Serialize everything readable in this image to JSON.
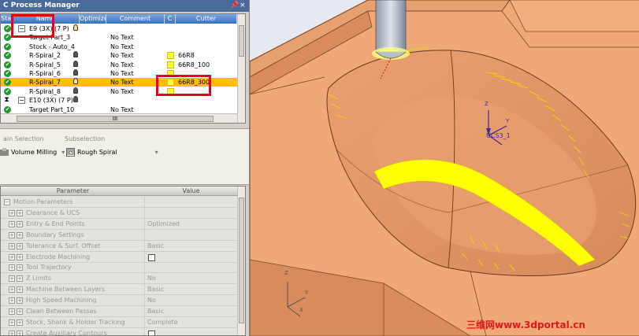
{
  "panel": {
    "title": "C Process Manager",
    "pin_glyph": "📌",
    "close_glyph": "×"
  },
  "tree": {
    "columns": [
      "Stat",
      "Name",
      "Optimizer",
      "Comment",
      "C",
      "Cutter"
    ],
    "rows": [
      {
        "status": "check",
        "expander": "−",
        "name": "E9 (3X) (7 P)",
        "bulb": "yellow",
        "comment": "",
        "swatch": false,
        "cutter": "",
        "selected": false
      },
      {
        "status": "check",
        "expander": "",
        "name": "Target Part_3",
        "bulb": "none",
        "comment": "No Text",
        "swatch": false,
        "cutter": "",
        "selected": false
      },
      {
        "status": "check",
        "expander": "",
        "name": "Stock - Auto_4",
        "bulb": "none",
        "comment": "No Text",
        "swatch": false,
        "cutter": "",
        "selected": false
      },
      {
        "status": "check",
        "expander": "",
        "name": "R-Spiral_2",
        "bulb": "dark",
        "comment": "No Text",
        "swatch": true,
        "cutter": "66R8",
        "selected": false
      },
      {
        "status": "check",
        "expander": "",
        "name": "R-Spiral_5",
        "bulb": "dark",
        "comment": "No Text",
        "swatch": true,
        "cutter": "66R8_100",
        "selected": false
      },
      {
        "status": "check",
        "expander": "",
        "name": "R-Spiral_6",
        "bulb": "dark",
        "comment": "No Text",
        "swatch": true,
        "cutter": "",
        "selected": false
      },
      {
        "status": "check",
        "expander": "",
        "name": "R-Spiral_7",
        "bulb": "yellow",
        "comment": "No Text",
        "swatch": true,
        "cutter": "66R8_300",
        "selected": true
      },
      {
        "status": "check",
        "expander": "",
        "name": "R-Spiral_8",
        "bulb": "dark",
        "comment": "No Text",
        "swatch": true,
        "cutter": "",
        "selected": false
      },
      {
        "status": "hourglass",
        "expander": "−",
        "name": "E10 (3X) (7 P)",
        "bulb": "dark",
        "comment": "",
        "swatch": false,
        "cutter": "",
        "selected": false
      },
      {
        "status": "check",
        "expander": "",
        "name": "Target Part_10",
        "bulb": "none",
        "comment": "No Text",
        "swatch": false,
        "cutter": "",
        "selected": false
      }
    ],
    "hscroll_glyph": "III"
  },
  "selection": {
    "main_label": "ain Selection",
    "main_value": "Volume Milling",
    "sub_label": "Subselection",
    "sub_value": "Rough Spiral"
  },
  "params": {
    "header_parameter": "Parameter",
    "header_value": "Value",
    "rows": [
      {
        "level": 0,
        "label": "Motion Parameters",
        "value": "",
        "checkbox": false
      },
      {
        "level": 1,
        "label": "Clearance & UCS",
        "value": "",
        "checkbox": false
      },
      {
        "level": 1,
        "label": "Entry & End Points",
        "value": "Optimized",
        "checkbox": false
      },
      {
        "level": 1,
        "label": "Boundary Settings",
        "value": "",
        "checkbox": false
      },
      {
        "level": 1,
        "label": "Tolerance & Surf. Offset",
        "value": "Basic",
        "checkbox": false
      },
      {
        "level": 1,
        "label": "Electrode Machining",
        "value": "",
        "checkbox": true
      },
      {
        "level": 1,
        "label": "Tool Trajectory",
        "value": "",
        "checkbox": false
      },
      {
        "level": 1,
        "label": "Z Limits",
        "value": "No",
        "checkbox": false
      },
      {
        "level": 1,
        "label": "Machine Between Layers",
        "value": "Basic",
        "checkbox": false
      },
      {
        "level": 1,
        "label": "High Speed Machining",
        "value": "No",
        "checkbox": false
      },
      {
        "level": 1,
        "label": "Clean Between Passes",
        "value": "Basic",
        "checkbox": false
      },
      {
        "level": 1,
        "label": "Stock, Shank & Holder Tracking",
        "value": "Complete",
        "checkbox": false
      },
      {
        "level": 1,
        "label": "Create Auxiliary Contours",
        "value": "",
        "checkbox": true
      }
    ]
  },
  "viewport": {
    "ucs_label": "UCS3_1",
    "axis_z": "Z",
    "axis_y": "Y",
    "axis_x": "X",
    "watermark": "三维网www.3dportal.cn"
  },
  "colors": {
    "part_top": "#f0a878",
    "part_side": "#d98b5e",
    "pocket_wall": "#e59a6b",
    "toolpath": "#ffff00",
    "selection": "#ffbf00",
    "highlight_box": "#e8001c",
    "title_bar": "#4a6a9a"
  }
}
